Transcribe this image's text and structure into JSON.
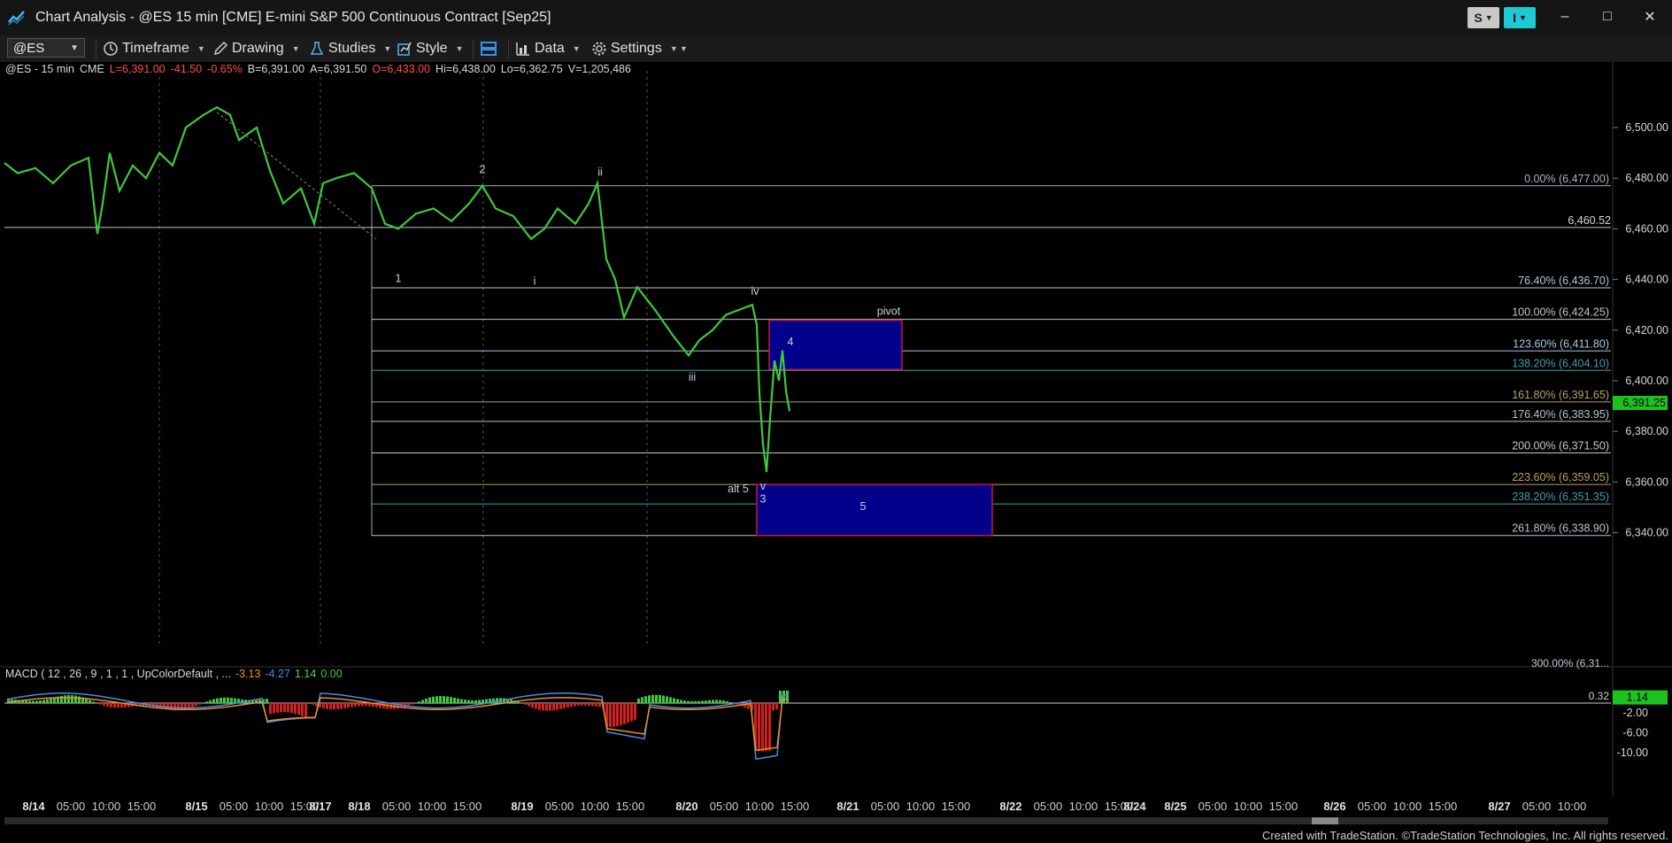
{
  "window": {
    "title": "Chart Analysis - @ES 15 min [CME] E-mini S&P 500 Continuous Contract [Sep25]",
    "s_button": "S",
    "i_button": "I",
    "minimize": "–",
    "maximize": "□",
    "close": "✕"
  },
  "toolbar": {
    "symbol": "@ES",
    "timeframe": "Timeframe",
    "drawing": "Drawing",
    "studies": "Studies",
    "style": "Style",
    "data": "Data",
    "settings": "Settings"
  },
  "info": {
    "symbol": "@ES - 15 min",
    "exchange": "CME",
    "last": "L=6,391.00",
    "net": "-41.50",
    "pct": "-0.65%",
    "bid": "B=6,391.00",
    "ask": "A=6,391.50",
    "open": "O=6,433.00",
    "high": "Hi=6,438.00",
    "low": "Lo=6,362.75",
    "volume": "V=1,205,486"
  },
  "macd": {
    "label": "MACD ( 12 , 26 , 9 , 1 , 1 , UpColorDefault , ...",
    "v1": "-3.13",
    "v2": "-4.27",
    "v3": "1.14",
    "v4": "0.00",
    "marker_zero": "0.32",
    "current": "1.14",
    "ticks": [
      "-2.00",
      "-6.00",
      "-10.00"
    ],
    "tick_values": [
      -2,
      -6,
      -10
    ]
  },
  "price_axis": {
    "ticks": [
      "6,500.00",
      "6,480.00",
      "6,460.00",
      "6,440.00",
      "6,420.00",
      "6,400.00",
      "6,380.00",
      "6,360.00",
      "6,340.00"
    ],
    "tick_values": [
      6500,
      6480,
      6460,
      6440,
      6420,
      6400,
      6380,
      6360,
      6340
    ],
    "current": "6,391.25",
    "current_value": 6391.25
  },
  "fib_levels": [
    {
      "label": "0.00% (6,477.00)",
      "value": 6477.0,
      "color": "#a9b4c2"
    },
    {
      "label": "76.40% (6,436.70)",
      "value": 6436.7,
      "color": "#b7c6d6"
    },
    {
      "label": "100.00% (6,424.25)",
      "value": 6424.25,
      "color": "#bfc6cc"
    },
    {
      "label": "123.60% (6,411.80)",
      "value": 6411.8,
      "color": "#a9c8e0"
    },
    {
      "label": "138.20% (6,404.10)",
      "value": 6404.1,
      "color": "#3fa0a6"
    },
    {
      "label": "161.80% (6,391.65)",
      "value": 6391.65,
      "color": "#b0a36a"
    },
    {
      "label": "176.40% (6,383.95)",
      "value": 6383.95,
      "color": "#b8c4d2"
    },
    {
      "label": "200.00% (6,371.50)",
      "value": 6371.5,
      "color": "#c0c8d4"
    },
    {
      "label": "223.60% (6,359.05)",
      "value": 6359.05,
      "color": "#b2a756"
    },
    {
      "label": "238.20% (6,351.35)",
      "value": 6351.35,
      "color": "#40a0a6"
    },
    {
      "label": "261.80% (6,338.90)",
      "value": 6338.9,
      "color": "#b8c4d2"
    }
  ],
  "fib_clipped_label": "300.00% (6,31...",
  "support_line": {
    "label": "6,460.52",
    "value": 6460.52
  },
  "wave_labels": [
    "1",
    "2",
    "i",
    "ii",
    "iii",
    "iv",
    "4",
    "pivot",
    "alt 5",
    "v",
    "3",
    "5"
  ],
  "time_axis": {
    "dates": [
      "8/14",
      "8/15",
      "8/17",
      "8/18",
      "8/19",
      "8/20",
      "8/21",
      "8/22",
      "8/24",
      "8/25",
      "8/26",
      "8/27"
    ],
    "times": [
      "05:00",
      "10:00",
      "15:00"
    ]
  },
  "colors": {
    "price": "#3ec93e",
    "macd_line": "#3f8ee8",
    "signal_line": "#ef8b23",
    "hist_up": "#3ec93e",
    "hist_down": "#d21f1f",
    "box_fill": "#00008b",
    "box_border": "#c8163c",
    "current_price_bg": "#1ec21e",
    "s_button_bg": "#c8c8c8",
    "i_button_bg": "#1ec8d4"
  },
  "footer": "Created with TradeStation. ©TradeStation Technologies, Inc. All rights reserved."
}
